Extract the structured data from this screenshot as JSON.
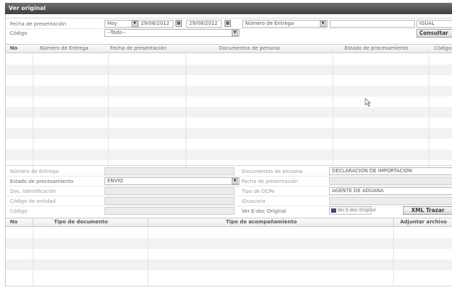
{
  "window": {
    "title": "Ver original"
  },
  "filters": {
    "fecha_label": "Fecha de presentación",
    "period_value": "Hoy",
    "date_from": "29/08/2012",
    "date_to": "29/08/2012",
    "search_field_value": "Número de Entrega",
    "search_text_value": "",
    "operator_value": "IGUAL",
    "codigo_label": "Código",
    "codigo_value": "--Todo--",
    "consultar_label": "Consultar"
  },
  "results_table": {
    "columns": [
      "No",
      "Número de Entrega",
      "Fecha de presentación",
      "Documentos de persona",
      "Estado de procesamiento",
      "Código"
    ],
    "rows": []
  },
  "detail": {
    "numero_entrega_label": "Número de Entrega",
    "numero_entrega_value": "",
    "documentos_persona_label": "Documentos de persona",
    "documentos_persona_value": "DECLARACION DE IMPORTACION",
    "estado_label": "Estado de procesamiento",
    "estado_value": "ENVIO",
    "fecha_label": "Fecha de presentación",
    "fecha_value": "",
    "doc_ident_label": "Doc. Identificación",
    "doc_ident_value": "",
    "tipo_ocpe_label": "Tipo de OCPe",
    "tipo_ocpe_value": "AGENTE DE ADUANA",
    "codigo_entidad_label": "Código de entidad",
    "codigo_entidad_value": "",
    "idusuario_label": "IDusuario",
    "idusuario_value": "",
    "codigo_label": "Código",
    "codigo_value": "",
    "ver_edoc_label": "Ver E-doc Original",
    "ver_edoc_button": "Ver E-doc Original",
    "xml_button": "XML Trazar"
  },
  "attachments_table": {
    "columns": [
      "No",
      "Tipo de documento",
      "Tipo de acompañamiento",
      "Adjuntar archivo"
    ],
    "rows": []
  },
  "colors": {
    "title_bar": "#4a4a4a",
    "row_alt": "#f2f2f2",
    "border": "#c4c4c4"
  }
}
